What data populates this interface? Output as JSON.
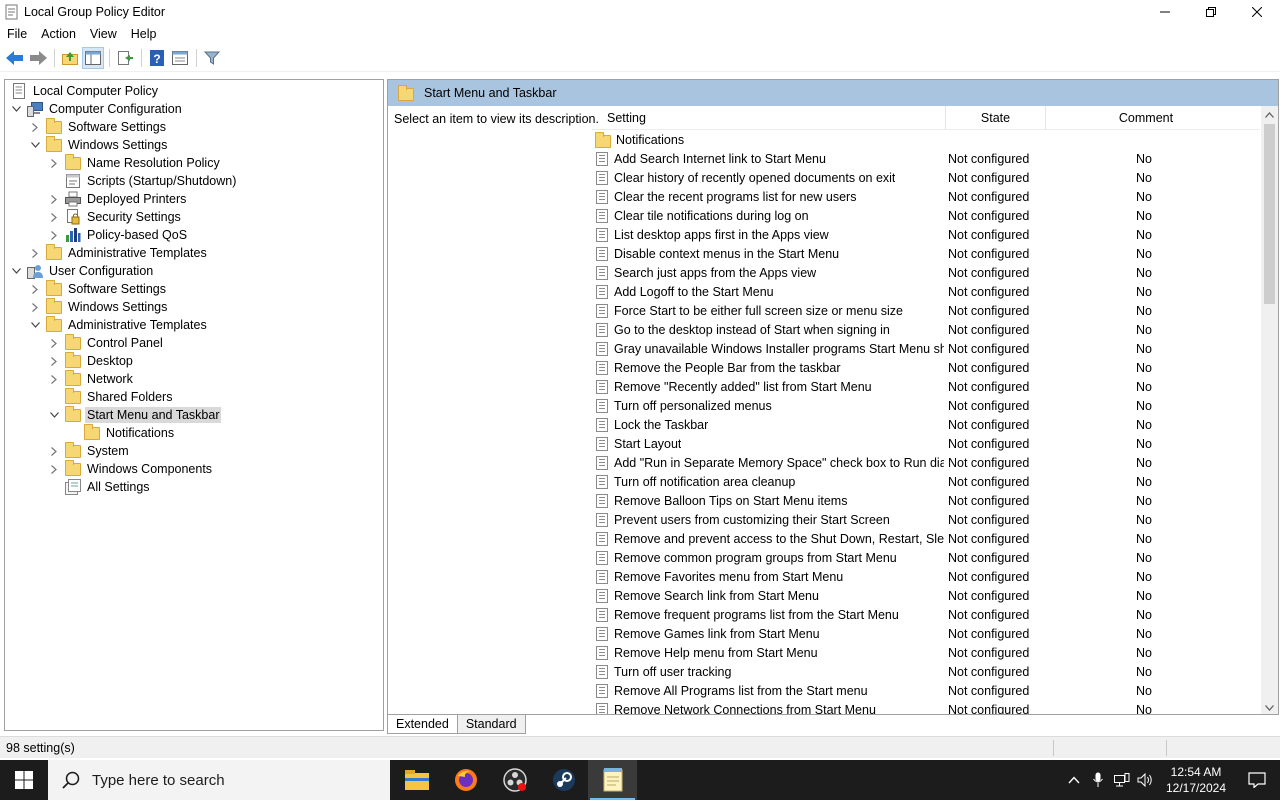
{
  "window": {
    "title": "Local Group Policy Editor",
    "controls": {
      "minimize": "—",
      "restore": "❐",
      "close": "✕"
    }
  },
  "menubar": [
    "File",
    "Action",
    "View",
    "Help"
  ],
  "toolbar": {
    "icons": [
      "back-arrow-icon",
      "forward-arrow-icon",
      "up-folder-icon",
      "show-hide-tree-icon",
      "export-list-icon",
      "help-icon",
      "properties-icon",
      "filter-icon"
    ]
  },
  "tree": [
    {
      "label": "Local Computer Policy",
      "level": 0,
      "expander": "",
      "icon": "policy-doc"
    },
    {
      "label": "Computer Configuration",
      "level": 0,
      "expander": "open",
      "icon": "computer"
    },
    {
      "label": "Software Settings",
      "level": 1,
      "expander": "closed",
      "icon": "folder"
    },
    {
      "label": "Windows Settings",
      "level": 1,
      "expander": "open",
      "icon": "folder"
    },
    {
      "label": "Name Resolution Policy",
      "level": 2,
      "expander": "closed",
      "icon": "folder"
    },
    {
      "label": "Scripts (Startup/Shutdown)",
      "level": 2,
      "expander": "",
      "icon": "script"
    },
    {
      "label": "Deployed Printers",
      "level": 2,
      "expander": "closed",
      "icon": "printer"
    },
    {
      "label": "Security Settings",
      "level": 2,
      "expander": "closed",
      "icon": "security"
    },
    {
      "label": "Policy-based QoS",
      "level": 2,
      "expander": "closed",
      "icon": "chart"
    },
    {
      "label": "Administrative Templates",
      "level": 1,
      "expander": "closed",
      "icon": "folder"
    },
    {
      "label": "User Configuration",
      "level": 0,
      "expander": "open",
      "icon": "user"
    },
    {
      "label": "Software Settings",
      "level": 1,
      "expander": "closed",
      "icon": "folder"
    },
    {
      "label": "Windows Settings",
      "level": 1,
      "expander": "closed",
      "icon": "folder"
    },
    {
      "label": "Administrative Templates",
      "level": 1,
      "expander": "open",
      "icon": "folder"
    },
    {
      "label": "Control Panel",
      "level": 2,
      "expander": "closed",
      "icon": "folder"
    },
    {
      "label": "Desktop",
      "level": 2,
      "expander": "closed",
      "icon": "folder"
    },
    {
      "label": "Network",
      "level": 2,
      "expander": "closed",
      "icon": "folder"
    },
    {
      "label": "Shared Folders",
      "level": 2,
      "expander": "",
      "icon": "folder"
    },
    {
      "label": "Start Menu and Taskbar",
      "level": 2,
      "expander": "open",
      "icon": "folder",
      "selected": true
    },
    {
      "label": "Notifications",
      "level": 3,
      "expander": "",
      "icon": "folder"
    },
    {
      "label": "System",
      "level": 2,
      "expander": "closed",
      "icon": "folder"
    },
    {
      "label": "Windows Components",
      "level": 2,
      "expander": "closed",
      "icon": "folder"
    },
    {
      "label": "All Settings",
      "level": 2,
      "expander": "",
      "icon": "all-settings"
    }
  ],
  "right_pane": {
    "header": "Start Menu and Taskbar",
    "description": "Select an item to view its description.",
    "columns": {
      "setting": "Setting",
      "state": "State",
      "comment": "Comment"
    },
    "folder_row": "Notifications",
    "rows": [
      {
        "setting": "Add Search Internet link to Start Menu",
        "state": "Not configured",
        "comment": "No"
      },
      {
        "setting": "Clear history of recently opened documents on exit",
        "state": "Not configured",
        "comment": "No"
      },
      {
        "setting": "Clear the recent programs list for new users",
        "state": "Not configured",
        "comment": "No"
      },
      {
        "setting": "Clear tile notifications during log on",
        "state": "Not configured",
        "comment": "No"
      },
      {
        "setting": "List desktop apps first in the Apps view",
        "state": "Not configured",
        "comment": "No"
      },
      {
        "setting": "Disable context menus in the Start Menu",
        "state": "Not configured",
        "comment": "No"
      },
      {
        "setting": "Search just apps from the Apps view",
        "state": "Not configured",
        "comment": "No"
      },
      {
        "setting": "Add Logoff to the Start Menu",
        "state": "Not configured",
        "comment": "No"
      },
      {
        "setting": "Force Start to be either full screen size or menu size",
        "state": "Not configured",
        "comment": "No"
      },
      {
        "setting": "Go to the desktop instead of Start when signing in",
        "state": "Not configured",
        "comment": "No"
      },
      {
        "setting": "Gray unavailable Windows Installer programs Start Menu sh...",
        "state": "Not configured",
        "comment": "No"
      },
      {
        "setting": "Remove the People Bar from the taskbar",
        "state": "Not configured",
        "comment": "No"
      },
      {
        "setting": "Remove \"Recently added\" list from Start Menu",
        "state": "Not configured",
        "comment": "No"
      },
      {
        "setting": "Turn off personalized menus",
        "state": "Not configured",
        "comment": "No"
      },
      {
        "setting": "Lock the Taskbar",
        "state": "Not configured",
        "comment": "No"
      },
      {
        "setting": "Start Layout",
        "state": "Not configured",
        "comment": "No"
      },
      {
        "setting": "Add \"Run in Separate Memory Space\" check box to Run dial...",
        "state": "Not configured",
        "comment": "No"
      },
      {
        "setting": "Turn off notification area cleanup",
        "state": "Not configured",
        "comment": "No"
      },
      {
        "setting": "Remove Balloon Tips on Start Menu items",
        "state": "Not configured",
        "comment": "No"
      },
      {
        "setting": "Prevent users from customizing their Start Screen",
        "state": "Not configured",
        "comment": "No"
      },
      {
        "setting": "Remove and prevent access to the Shut Down, Restart, Sleep...",
        "state": "Not configured",
        "comment": "No"
      },
      {
        "setting": "Remove common program groups from Start Menu",
        "state": "Not configured",
        "comment": "No"
      },
      {
        "setting": "Remove Favorites menu from Start Menu",
        "state": "Not configured",
        "comment": "No"
      },
      {
        "setting": "Remove Search link from Start Menu",
        "state": "Not configured",
        "comment": "No"
      },
      {
        "setting": "Remove frequent programs list from the Start Menu",
        "state": "Not configured",
        "comment": "No"
      },
      {
        "setting": "Remove Games link from Start Menu",
        "state": "Not configured",
        "comment": "No"
      },
      {
        "setting": "Remove Help menu from Start Menu",
        "state": "Not configured",
        "comment": "No"
      },
      {
        "setting": "Turn off user tracking",
        "state": "Not configured",
        "comment": "No"
      },
      {
        "setting": "Remove All Programs list from the Start menu",
        "state": "Not configured",
        "comment": "No"
      },
      {
        "setting": "Remove Network Connections from Start Menu",
        "state": "Not configured",
        "comment": "No"
      }
    ]
  },
  "tabs": [
    {
      "label": "Extended",
      "active": true
    },
    {
      "label": "Standard",
      "active": false
    }
  ],
  "statusbar": {
    "text": "98 setting(s)"
  },
  "taskbar": {
    "search_placeholder": "Type here to search",
    "apps": [
      "file-explorer-icon",
      "firefox-icon",
      "obs-icon",
      "steam-icon",
      "notepad-icon"
    ],
    "clock_time": "12:54 AM",
    "clock_date": "12/17/2024"
  },
  "colors": {
    "header_bar": "#a9c4de",
    "selection": "#d9d9d9",
    "taskbar": "#1c1c1c"
  }
}
